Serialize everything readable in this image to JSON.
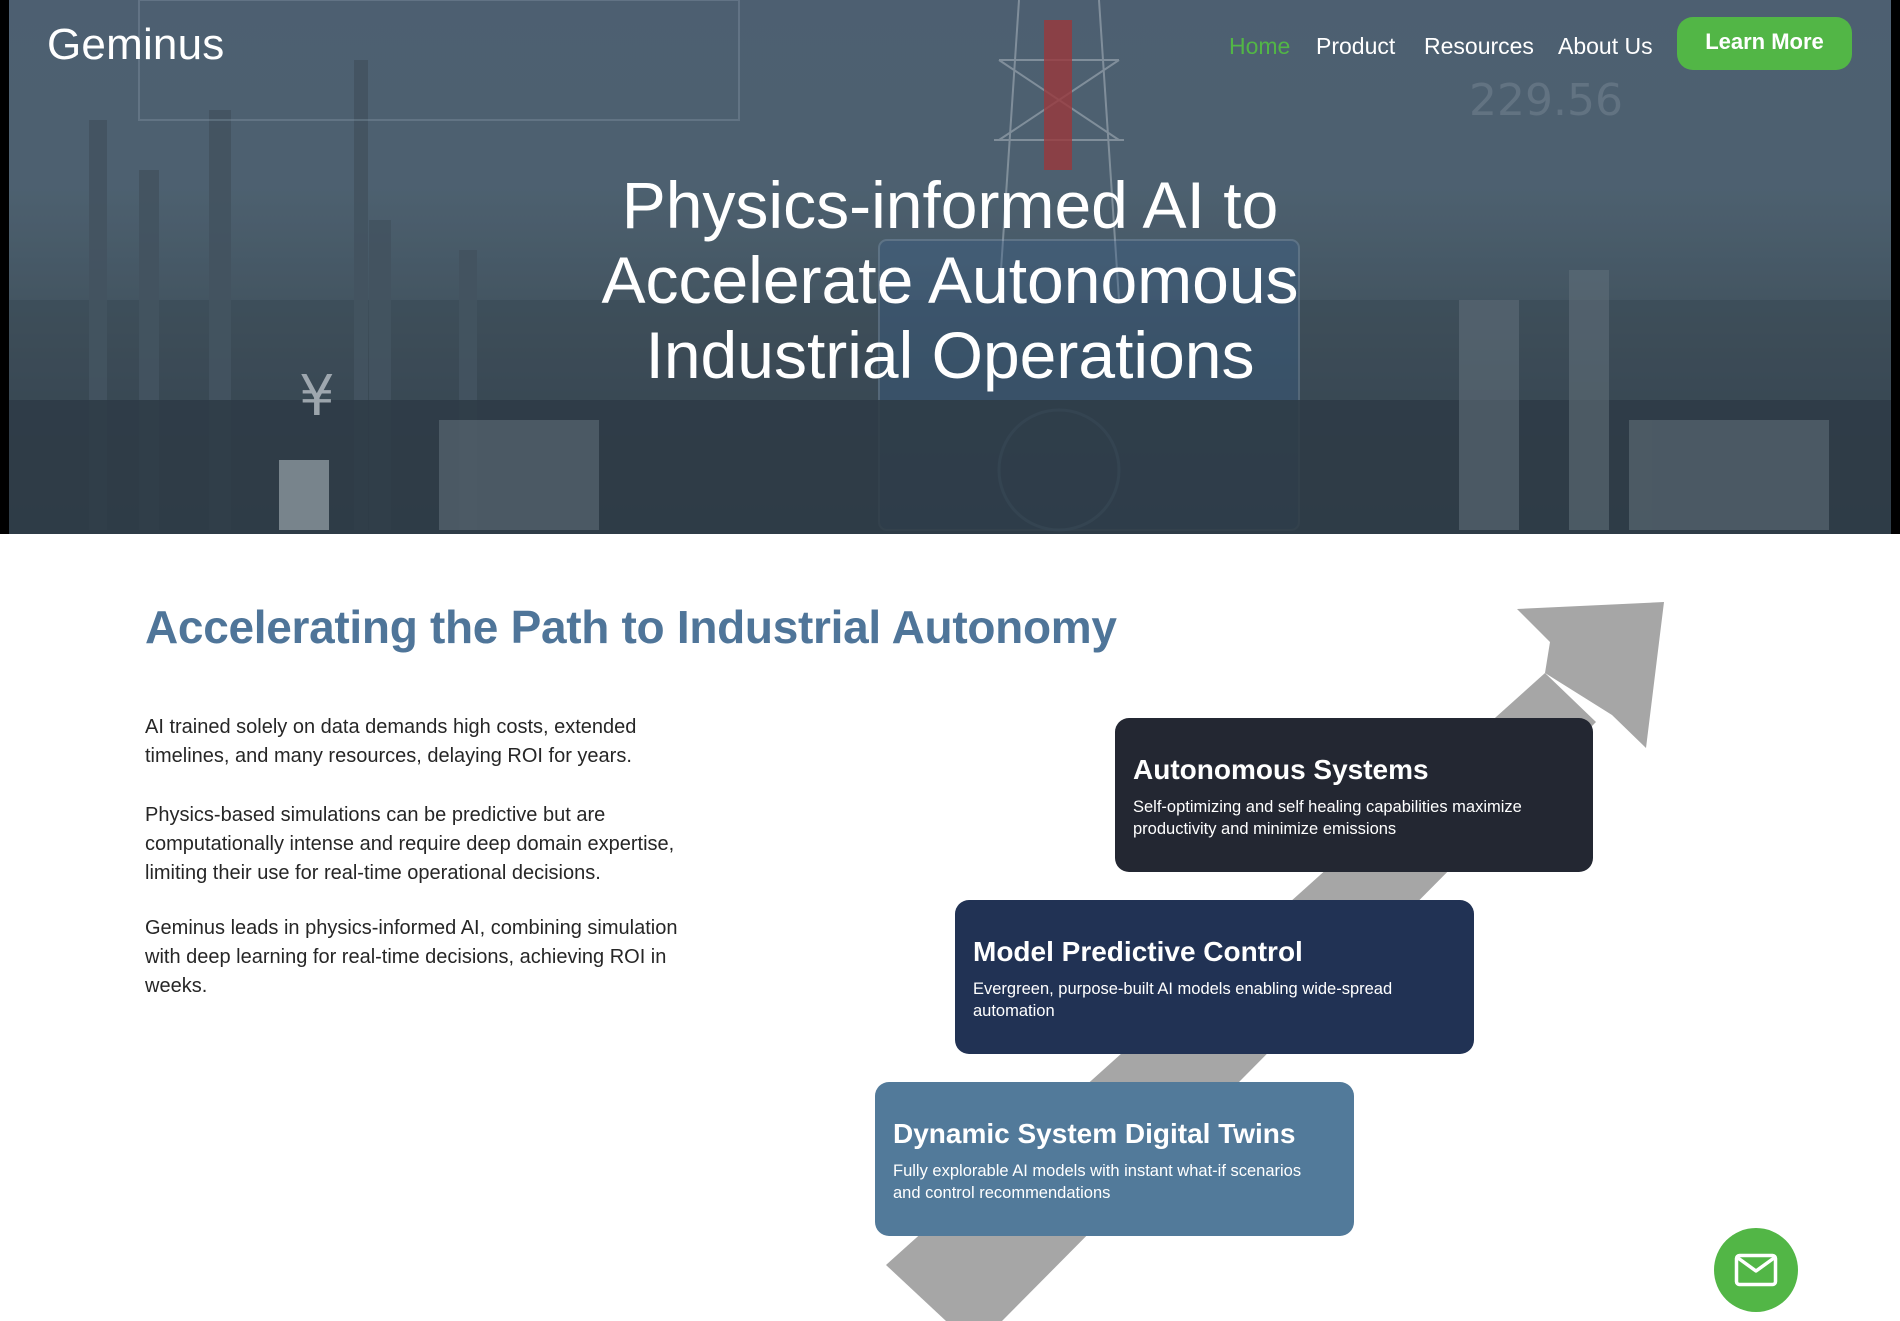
{
  "header": {
    "logo": "Geminus",
    "nav": [
      {
        "label": "Home",
        "active": true
      },
      {
        "label": "Product",
        "active": false
      },
      {
        "label": "Resources",
        "active": false
      },
      {
        "label": "About Us",
        "active": false
      }
    ],
    "cta_label": "Learn More"
  },
  "hero": {
    "title_lines": [
      "Physics-informed AI to",
      "Accelerate Autonomous",
      "Industrial Operations"
    ],
    "background_readout": "229.56"
  },
  "section": {
    "title": "Accelerating the Path to Industrial Autonomy",
    "paragraphs": [
      "AI trained solely on data demands high costs, extended timelines, and many resources, delaying ROI for years.",
      "Physics-based simulations can be predictive but are computationally intense and require deep domain expertise, limiting their use for real-time operational decisions.",
      "Geminus leads in physics-informed AI, combining simulation with deep learning for real-time decisions, achieving ROI in weeks."
    ],
    "cards": [
      {
        "title": "Autonomous Systems",
        "description": "Self-optimizing and self healing capabilities maximize productivity and minimize emissions"
      },
      {
        "title": "Model Predictive Control",
        "description": "Evergreen, purpose-built AI models enabling wide-spread automation"
      },
      {
        "title": "Dynamic System Digital Twins",
        "description": "Fully explorable AI models with instant what-if scenarios and control recommendations"
      }
    ]
  },
  "contact": {
    "icon": "mail-icon"
  },
  "colors": {
    "accent_green": "#52b646",
    "heading_blue": "#4f7599",
    "card_dark": "#232732",
    "card_navy": "#213254",
    "card_steel": "#527a9a",
    "arrow_gray": "#a6a6a6"
  }
}
